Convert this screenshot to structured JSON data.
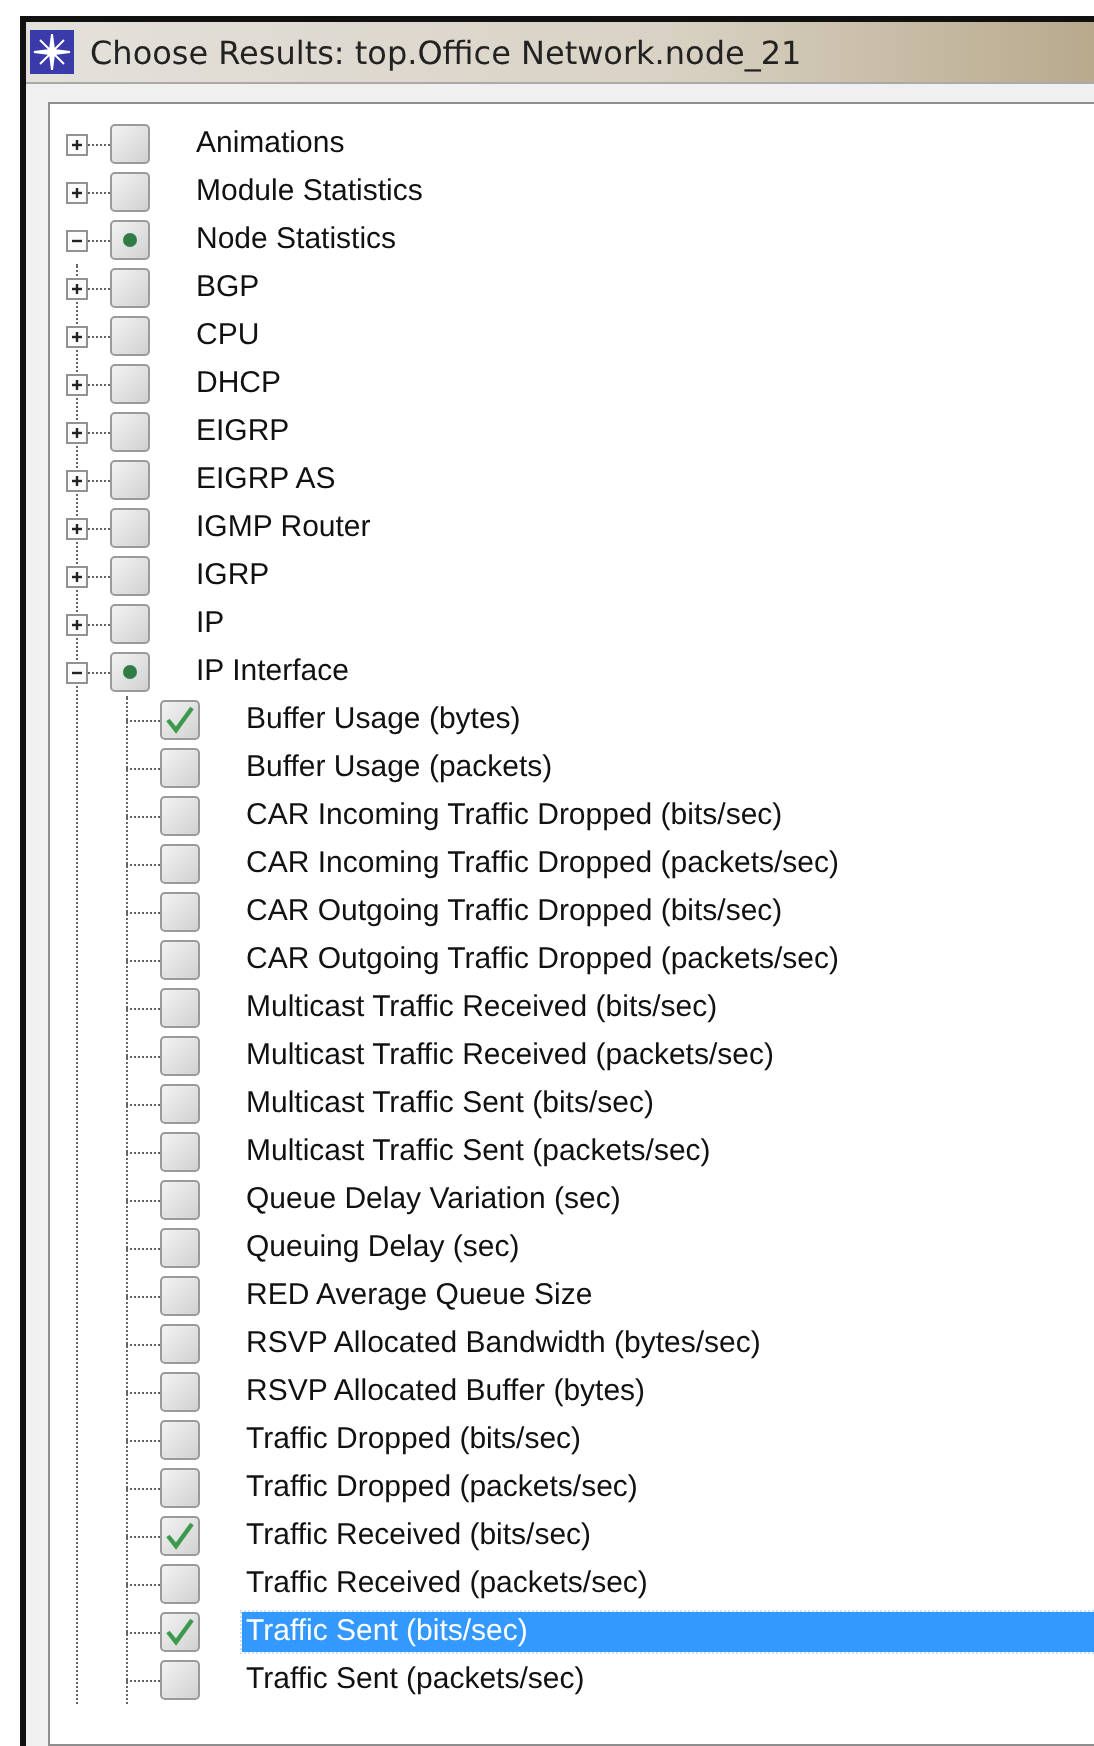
{
  "window": {
    "title": "Choose Results: top.Office Network.node_21"
  },
  "tree": [
    {
      "label": "Animations",
      "checked": false,
      "partial": false,
      "expanded": false,
      "selected": false
    },
    {
      "label": "Module Statistics",
      "checked": false,
      "partial": false,
      "expanded": false,
      "selected": false
    },
    {
      "label": "Node Statistics",
      "checked": false,
      "partial": true,
      "expanded": true,
      "selected": false,
      "children": [
        {
          "label": "BGP",
          "checked": false,
          "partial": false,
          "expanded": false,
          "selected": false
        },
        {
          "label": "CPU",
          "checked": false,
          "partial": false,
          "expanded": false,
          "selected": false
        },
        {
          "label": "DHCP",
          "checked": false,
          "partial": false,
          "expanded": false,
          "selected": false
        },
        {
          "label": "EIGRP",
          "checked": false,
          "partial": false,
          "expanded": false,
          "selected": false
        },
        {
          "label": "EIGRP AS",
          "checked": false,
          "partial": false,
          "expanded": false,
          "selected": false
        },
        {
          "label": "IGMP Router",
          "checked": false,
          "partial": false,
          "expanded": false,
          "selected": false
        },
        {
          "label": "IGRP",
          "checked": false,
          "partial": false,
          "expanded": false,
          "selected": false
        },
        {
          "label": "IP",
          "checked": false,
          "partial": false,
          "expanded": false,
          "selected": false
        },
        {
          "label": "IP Interface",
          "checked": false,
          "partial": true,
          "expanded": true,
          "selected": false,
          "children": [
            {
              "label": "Buffer Usage (bytes)",
              "checked": true,
              "partial": false,
              "selected": false
            },
            {
              "label": "Buffer Usage (packets)",
              "checked": false,
              "partial": false,
              "selected": false
            },
            {
              "label": "CAR Incoming Traffic Dropped (bits/sec)",
              "checked": false,
              "partial": false,
              "selected": false
            },
            {
              "label": "CAR Incoming Traffic Dropped (packets/sec)",
              "checked": false,
              "partial": false,
              "selected": false
            },
            {
              "label": "CAR Outgoing Traffic Dropped (bits/sec)",
              "checked": false,
              "partial": false,
              "selected": false
            },
            {
              "label": "CAR Outgoing Traffic Dropped (packets/sec)",
              "checked": false,
              "partial": false,
              "selected": false
            },
            {
              "label": "Multicast Traffic Received (bits/sec)",
              "checked": false,
              "partial": false,
              "selected": false
            },
            {
              "label": "Multicast Traffic Received (packets/sec)",
              "checked": false,
              "partial": false,
              "selected": false
            },
            {
              "label": "Multicast Traffic Sent (bits/sec)",
              "checked": false,
              "partial": false,
              "selected": false
            },
            {
              "label": "Multicast Traffic Sent (packets/sec)",
              "checked": false,
              "partial": false,
              "selected": false
            },
            {
              "label": "Queue Delay Variation (sec)",
              "checked": false,
              "partial": false,
              "selected": false
            },
            {
              "label": "Queuing Delay (sec)",
              "checked": false,
              "partial": false,
              "selected": false
            },
            {
              "label": "RED Average Queue Size",
              "checked": false,
              "partial": false,
              "selected": false
            },
            {
              "label": "RSVP Allocated Bandwidth (bytes/sec)",
              "checked": false,
              "partial": false,
              "selected": false
            },
            {
              "label": "RSVP Allocated Buffer (bytes)",
              "checked": false,
              "partial": false,
              "selected": false
            },
            {
              "label": "Traffic Dropped (bits/sec)",
              "checked": false,
              "partial": false,
              "selected": false
            },
            {
              "label": "Traffic Dropped (packets/sec)",
              "checked": false,
              "partial": false,
              "selected": false
            },
            {
              "label": "Traffic Received (bits/sec)",
              "checked": true,
              "partial": false,
              "selected": false
            },
            {
              "label": "Traffic Received (packets/sec)",
              "checked": false,
              "partial": false,
              "selected": false
            },
            {
              "label": "Traffic Sent (bits/sec)",
              "checked": true,
              "partial": false,
              "selected": true
            },
            {
              "label": "Traffic Sent (packets/sec)",
              "checked": false,
              "partial": false,
              "selected": false
            }
          ]
        }
      ]
    }
  ]
}
